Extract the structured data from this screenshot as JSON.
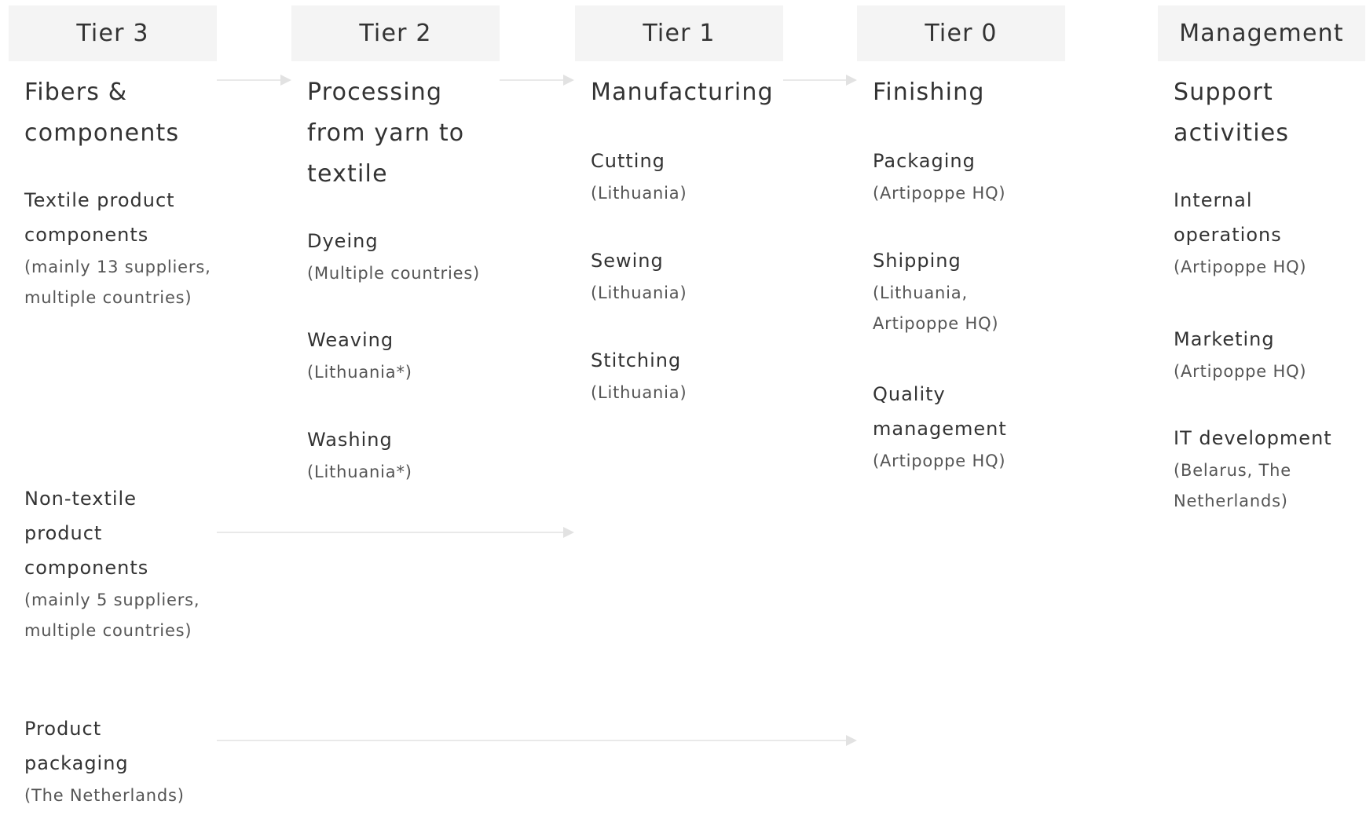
{
  "columns": [
    {
      "header": "Tier 3",
      "title": "Fibers & components",
      "items": [
        {
          "name": "Textile product components",
          "sub": "(mainly 13 suppliers, multiple countries)"
        },
        {
          "name": "Non-textile product components",
          "sub": "(mainly 5 suppliers, multiple countries)"
        },
        {
          "name": "Product packaging",
          "sub": "(The Netherlands)"
        }
      ]
    },
    {
      "header": "Tier 2",
      "title": "Processing from yarn to textile",
      "items": [
        {
          "name": "Dyeing",
          "sub": "(Multiple countries)"
        },
        {
          "name": "Weaving",
          "sub": "(Lithuania*)"
        },
        {
          "name": "Washing",
          "sub": "(Lithuania*)"
        }
      ]
    },
    {
      "header": "Tier 1",
      "title": "Manufacturing",
      "items": [
        {
          "name": "Cutting",
          "sub": "(Lithuania)"
        },
        {
          "name": "Sewing",
          "sub": "(Lithuania)"
        },
        {
          "name": "Stitching",
          "sub": "(Lithuania)"
        }
      ]
    },
    {
      "header": "Tier 0",
      "title": "Finishing",
      "items": [
        {
          "name": "Packaging",
          "sub": "(Artipoppe HQ)"
        },
        {
          "name": "Shipping",
          "sub": "(Lithuania, Artipoppe HQ)"
        },
        {
          "name": "Quality management",
          "sub": "(Artipoppe HQ)"
        }
      ]
    },
    {
      "header": "Management",
      "title": "Support activities",
      "items": [
        {
          "name": "Internal operations",
          "sub": "(Artipoppe HQ)"
        },
        {
          "name": "Marketing",
          "sub": "(Artipoppe HQ)"
        },
        {
          "name": "IT development",
          "sub": "(Belarus, The Netherlands)"
        }
      ]
    }
  ],
  "colors": {
    "header_bg": "#f4f4f4",
    "arrow": "#e2e2e2",
    "text": "#333333"
  }
}
